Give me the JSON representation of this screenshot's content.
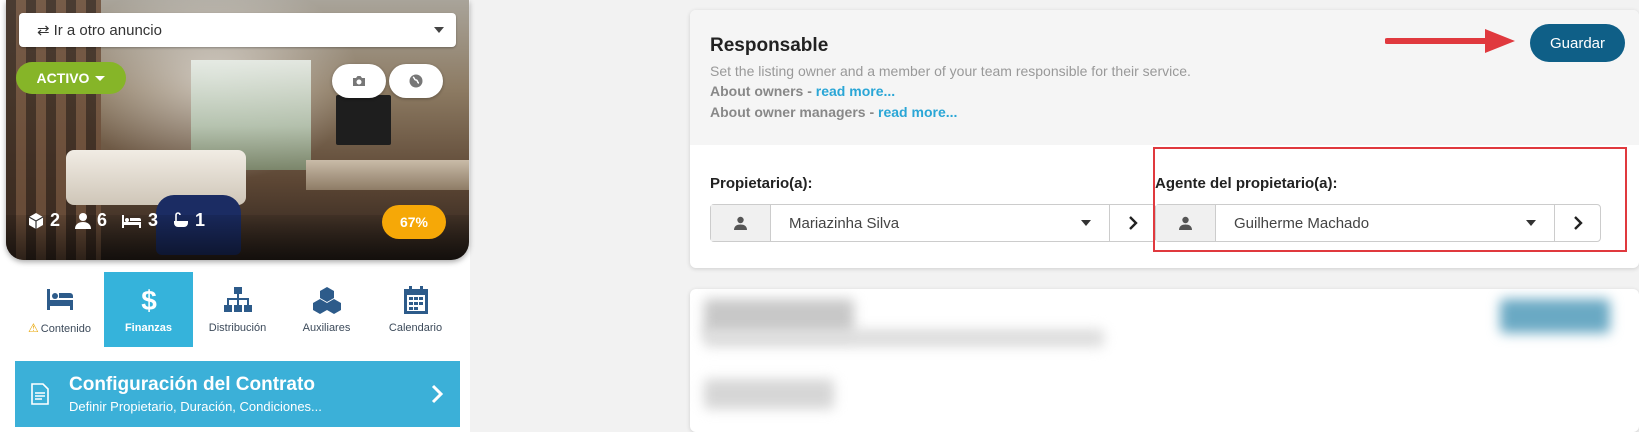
{
  "listing": {
    "goto_label": "Ir a otro anuncio",
    "status_label": "ACTIVO",
    "stats": {
      "units": "2",
      "guests": "6",
      "beds": "3",
      "baths": "1"
    },
    "completion": "67%"
  },
  "tabs": [
    {
      "label": "Contenido",
      "icon": "bed-icon",
      "warning": true
    },
    {
      "label": "Finanzas",
      "icon": "dollar-icon",
      "active": true
    },
    {
      "label": "Distribución",
      "icon": "sitemap-icon"
    },
    {
      "label": "Auxiliares",
      "icon": "cubes-icon"
    },
    {
      "label": "Calendario",
      "icon": "calendar-icon"
    }
  ],
  "contract": {
    "title": "Configuración del Contrato",
    "subtitle": "Definir Propietario, Duración, Condiciones..."
  },
  "responsable": {
    "title": "Responsable",
    "description": "Set the listing owner and a member of your team responsible for their service.",
    "about_owners_prefix": "About owners - ",
    "about_managers_prefix": "About owner managers - ",
    "read_more": "read more...",
    "save_label": "Guardar",
    "owner_label": "Propietario(a):",
    "owner_value": "Mariazinha Silva",
    "agent_label": "Agente del propietario(a):",
    "agent_value": "Guilherme Machado"
  },
  "colors": {
    "accent": "#35b3db",
    "save_button": "#0f5f87",
    "active_badge": "#86b528",
    "completion_badge": "#f6a807",
    "highlight_red": "#e0393e"
  }
}
